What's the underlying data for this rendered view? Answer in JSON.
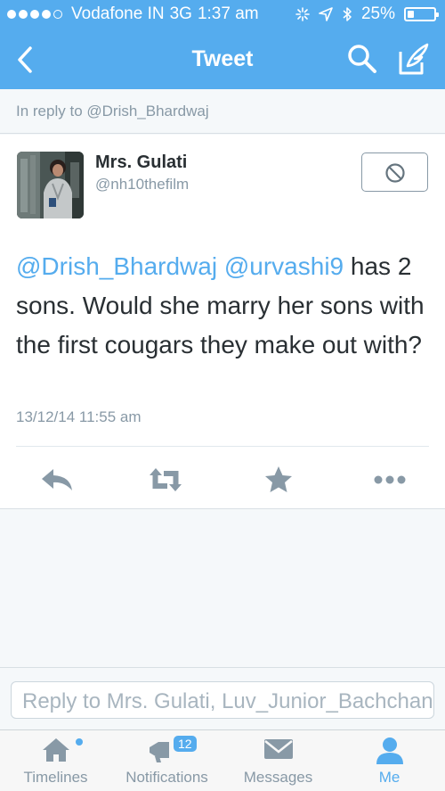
{
  "status_bar": {
    "carrier": "Vodafone IN",
    "network": "3G",
    "time": "1:37 am",
    "battery_percent": "25%",
    "battery_level": 0.25
  },
  "nav": {
    "title": "Tweet",
    "back_icon": "chevron-left-icon",
    "search_icon": "search-icon",
    "compose_icon": "compose-icon"
  },
  "reply_context": "In reply to @Drish_Bhardwaj",
  "tweet": {
    "user_name": "Mrs. Gulati",
    "user_handle": "@nh10thefilm",
    "mention1": "@Drish_Bhardwaj",
    "mention2": "@urvashi9",
    "text_rest": " has 2 sons. Would she marry her sons with the first cougars they make out with?",
    "timestamp": "13/12/14 11:55 am"
  },
  "compose": {
    "placeholder": "Reply to Mrs. Gulati, Luv_Junior_Bachchan"
  },
  "tabs": [
    {
      "label": "Timelines",
      "icon": "home-icon"
    },
    {
      "label": "Notifications",
      "icon": "notifications-icon",
      "badge": "12"
    },
    {
      "label": "Messages",
      "icon": "envelope-icon"
    },
    {
      "label": "Me",
      "icon": "person-icon"
    }
  ],
  "colors": {
    "brand": "#55acee",
    "text": "#292f33",
    "muted": "#8899a6"
  }
}
